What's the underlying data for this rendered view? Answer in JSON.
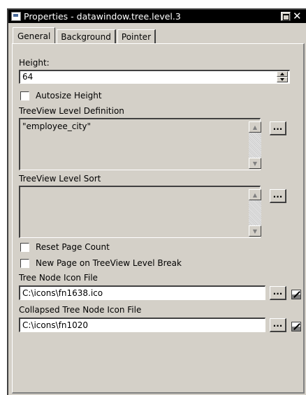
{
  "window": {
    "title": "Properties - datawindow.tree.level.3"
  },
  "tabs": [
    {
      "label": "General",
      "active": true
    },
    {
      "label": "Background",
      "active": false
    },
    {
      "label": "Pointer",
      "active": false
    }
  ],
  "general": {
    "height_label": "Height:",
    "height_value": "64",
    "autosize_label": "Autosize Height",
    "autosize_checked": false,
    "level_definition_label": "TreeView Level Definition",
    "level_definition_value": "\"employee_city\"",
    "level_sort_label": "TreeView Level Sort",
    "level_sort_value": "",
    "reset_page_count_label": "Reset Page Count",
    "reset_page_count_checked": false,
    "new_page_label": "New Page on TreeView Level Break",
    "new_page_checked": false,
    "icon_file_label": "Tree Node Icon File",
    "icon_file_value": "C:\\icons\\fn1638.ico",
    "collapsed_icon_file_label": "Collapsed Tree Node Icon File",
    "collapsed_icon_file_value": "C:\\icons\\fn1020",
    "ellipsis_label": "..."
  },
  "icons": {
    "window_icon": "properties-window-icon",
    "restore": "restore-icon",
    "close": "close-icon",
    "scroll_up": "scroll-up-arrow-icon",
    "scroll_down": "scroll-down-arrow-icon",
    "spin_up": "spin-up-arrow-icon",
    "spin_down": "spin-down-arrow-icon",
    "icon_picker": "icon-picker-icon"
  }
}
